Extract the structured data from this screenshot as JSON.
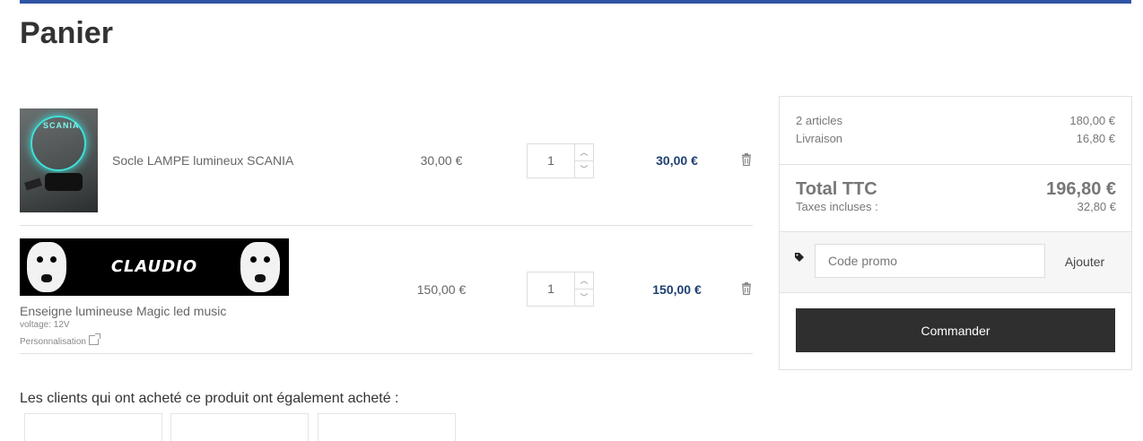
{
  "page": {
    "title": "Panier"
  },
  "cart": {
    "items": [
      {
        "name": "Socle LAMPE lumineux SCANIA",
        "image_text": "SCANIA",
        "unit_price": "30,00 €",
        "quantity": "1",
        "line_total": "30,00 €"
      },
      {
        "name": "Enseigne lumineuse Magic led music",
        "image_text": "CLAUDIO",
        "attribute": "voltage: 12V",
        "customization_link": "Personnalisation",
        "unit_price": "150,00 €",
        "quantity": "1",
        "line_total": "150,00 €"
      }
    ]
  },
  "summary": {
    "articles_label": "2 articles",
    "articles_value": "180,00 €",
    "shipping_label": "Livraison",
    "shipping_value": "16,80 €",
    "total_label": "Total TTC",
    "total_value": "196,80 €",
    "tax_label": "Taxes incluses :",
    "tax_value": "32,80 €",
    "promo_placeholder": "Code promo",
    "promo_button": "Ajouter",
    "checkout_button": "Commander"
  },
  "also_bought": {
    "heading": "Les clients qui ont acheté ce produit ont également acheté :"
  },
  "colors": {
    "accent_bar": "#2f54a4",
    "price_text": "#1f3f73",
    "checkout_bg": "#2f2f2f"
  },
  "icons": [
    "trash-icon",
    "tag-icon",
    "external-link-icon",
    "chevron-up-icon",
    "chevron-down-icon"
  ]
}
